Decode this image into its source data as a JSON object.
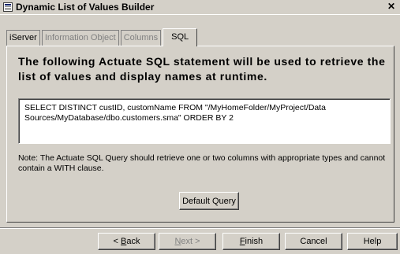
{
  "window": {
    "title": "Dynamic List of Values Builder",
    "close_glyph": "✕"
  },
  "tabs": [
    {
      "label": "iServer"
    },
    {
      "label": "Information Object"
    },
    {
      "label": "Columns"
    },
    {
      "label": "SQL"
    }
  ],
  "sql_panel": {
    "heading": "The following Actuate SQL statement will be used to retrieve the list of values and display names at runtime.",
    "sql_text": "SELECT DISTINCT custID, customName FROM \"/MyHomeFolder/MyProject/Data Sources/MyDatabase/dbo.customers.sma\" ORDER BY 2",
    "note": "Note: The Actuate SQL Query should retrieve one or two  columns with appropriate types and cannot contain a WITH clause.",
    "default_query_label": "Default Query"
  },
  "footer": {
    "back_pre": "< ",
    "back_key": "B",
    "back_post": "ack",
    "next_key": "N",
    "next_post": "ext >",
    "finish_key": "F",
    "finish_post": "inish",
    "cancel_label": "Cancel",
    "help_label": "Help"
  },
  "colors": {
    "face": "#d4d0c8",
    "shadow": "#808080",
    "highlight": "#ffffff",
    "disabled_text": "#808080"
  },
  "icons": {
    "app": "list-builder-icon",
    "close": "close-icon"
  }
}
